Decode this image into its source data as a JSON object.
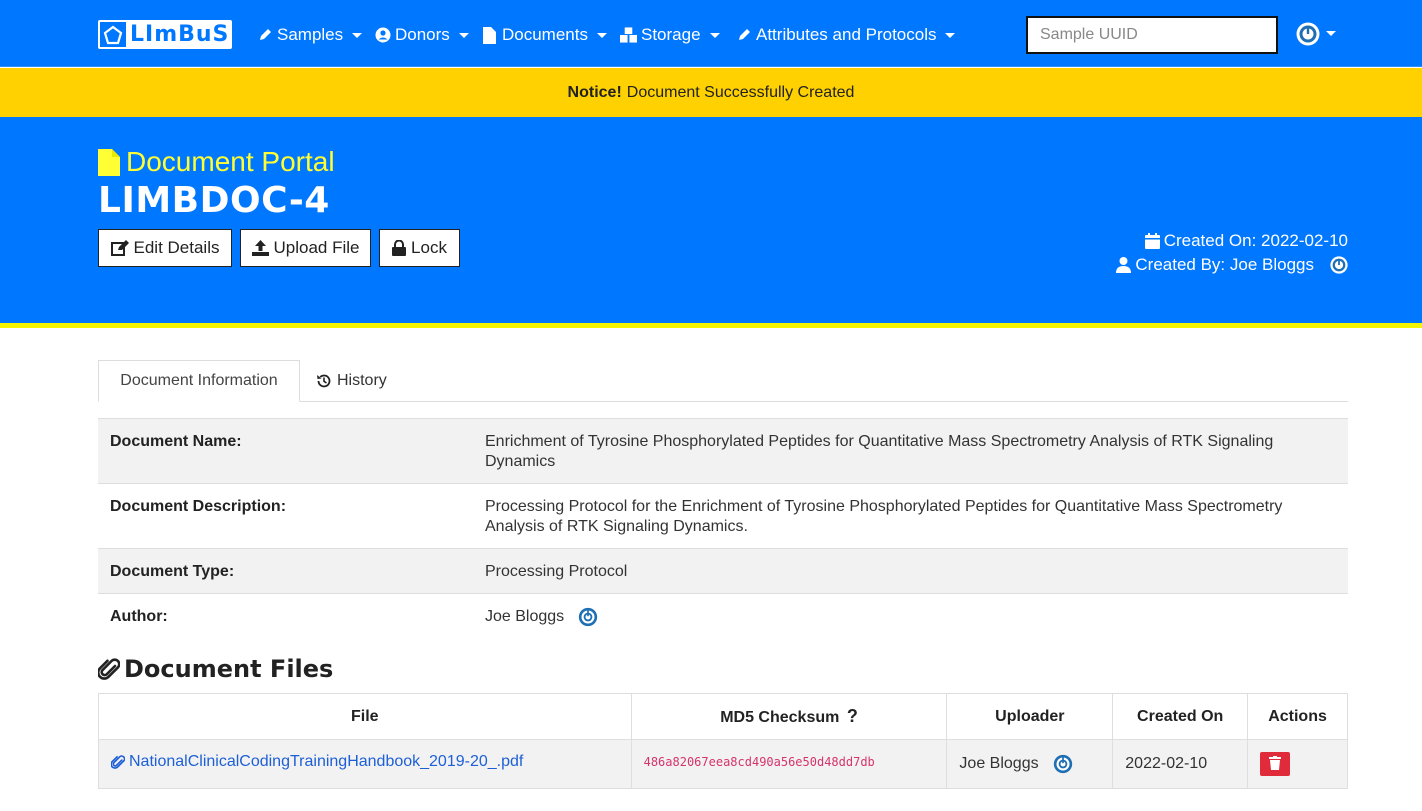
{
  "navbar": {
    "brand": "LImBuS",
    "items": [
      {
        "label": "Samples",
        "icon": "pen-icon"
      },
      {
        "label": "Donors",
        "icon": "user-circle-icon"
      },
      {
        "label": "Documents",
        "icon": "file-icon"
      },
      {
        "label": "Storage",
        "icon": "boxes-icon"
      },
      {
        "label": "Attributes and Protocols",
        "icon": "pen-icon"
      }
    ],
    "search_placeholder": "Sample UUID",
    "user_icon": "orcid-icon"
  },
  "notice": {
    "strong": "Notice!",
    "text": "Document Successfully Created"
  },
  "header": {
    "portal_title": "Document Portal",
    "doc_id": "LIMBDOC-4",
    "buttons": {
      "edit": "Edit Details",
      "upload": "Upload File",
      "lock": "Lock"
    },
    "created_on": "Created On: 2022-02-10",
    "created_by": "Created By: Joe Bloggs"
  },
  "tabs": {
    "info": "Document Information",
    "history": "History"
  },
  "info": {
    "name_label": "Document Name:",
    "name_value": "Enrichment of Tyrosine Phosphorylated Peptides for Quantitative Mass Spectrometry Analysis of RTK Signaling Dynamics",
    "desc_label": "Document Description:",
    "desc_value": "Processing Protocol for the Enrichment of Tyrosine Phosphorylated Peptides for Quantitative Mass Spectrometry Analysis of RTK Signaling Dynamics.",
    "type_label": "Document Type:",
    "type_value": "Processing Protocol",
    "author_label": "Author:",
    "author_value": "Joe Bloggs"
  },
  "files": {
    "title": "Document Files",
    "columns": {
      "file": "File",
      "md5": "MD5 Checksum",
      "uploader": "Uploader",
      "created": "Created On",
      "actions": "Actions"
    },
    "rows": [
      {
        "file": "NationalClinicalCodingTrainingHandbook_2019-20_.pdf",
        "md5": "486a82067eea8cd490a56e50d48dd7db",
        "uploader": "Joe Bloggs",
        "created": "2022-02-10"
      }
    ]
  },
  "colors": {
    "primary": "#0077ff",
    "accent_yellow": "#ffd100",
    "title_yellow": "#ffff33",
    "danger": "#e02b3a",
    "link": "#1d5fd6",
    "code": "#d6336c"
  }
}
